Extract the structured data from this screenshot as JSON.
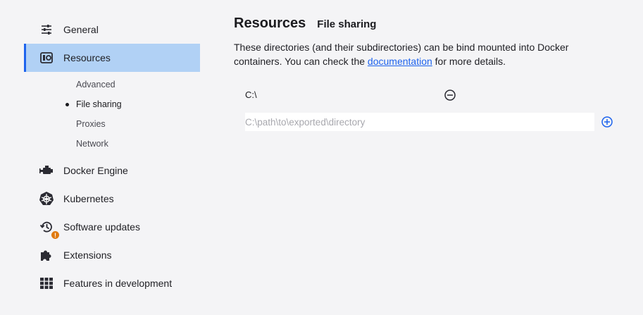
{
  "sidebar": {
    "items": [
      {
        "label": "General",
        "icon": "sliders-icon"
      },
      {
        "label": "Resources",
        "icon": "resources-icon",
        "active": true
      },
      {
        "label": "Docker Engine",
        "icon": "docker-engine-icon"
      },
      {
        "label": "Kubernetes",
        "icon": "kubernetes-icon"
      },
      {
        "label": "Software updates",
        "icon": "history-icon",
        "badge": "!"
      },
      {
        "label": "Extensions",
        "icon": "puzzle-icon"
      },
      {
        "label": "Features in development",
        "icon": "grid-icon"
      }
    ],
    "resources_sub": [
      {
        "label": "Advanced"
      },
      {
        "label": "File sharing",
        "active": true
      },
      {
        "label": "Proxies"
      },
      {
        "label": "Network"
      }
    ]
  },
  "main": {
    "title": "Resources",
    "section": "File sharing",
    "description_before": "These directories (and their subdirectories) can be bind mounted into Docker containers. You can check the ",
    "description_link": "documentation",
    "description_after": " for more details.",
    "shared_dirs": [
      "C:\\"
    ],
    "path_input": {
      "value": "",
      "placeholder": "C:\\path\\to\\exported\\directory"
    }
  },
  "colors": {
    "accent": "#1d63ed",
    "active_bg": "#b1d1f5",
    "badge": "#e07a10",
    "background": "#f4f4f6"
  }
}
